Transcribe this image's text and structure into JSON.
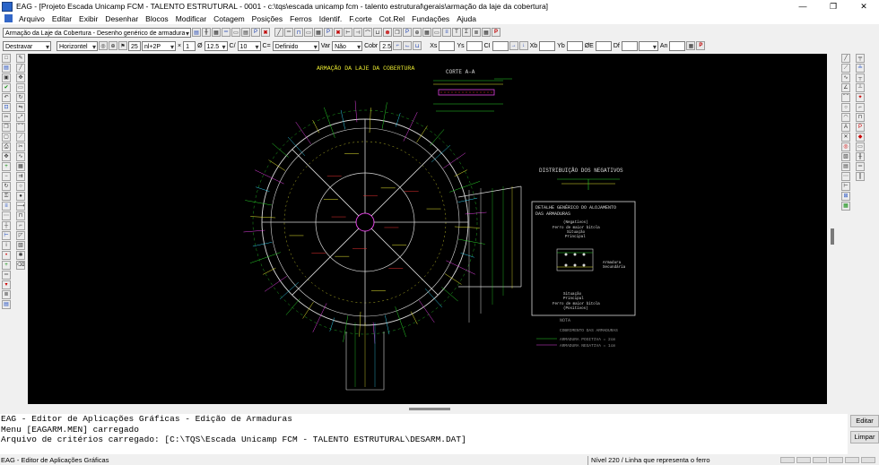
{
  "window": {
    "title": "EAG - [Projeto Escada Unicamp FCM - TALENTO ESTRUTURAL - 0001 - c:\\tqs\\escada unicamp fcm - talento estrutural\\gerais\\armação da laje da cobertura]",
    "minimize": "—",
    "maximize": "❐",
    "close": "✕"
  },
  "menu": [
    "Arquivo",
    "Editar",
    "Exibir",
    "Desenhar",
    "Blocos",
    "Modificar",
    "Cotagem",
    "Posições",
    "Ferros",
    "Identif.",
    "F.corte",
    "Cot.Rel",
    "Fundações",
    "Ajuda"
  ],
  "toolbar1": {
    "drawing_combo": "Armação da Laje da Cobertura - Desenho genérico de armadura"
  },
  "toolbar2": {
    "mode": "Destravar",
    "orientation": "Horizontel",
    "position_value": "25",
    "bar_spec": "nl+2P",
    "mult_label": "×",
    "mult_value": "1",
    "diameter_label": "Ø",
    "diameter_value": "12.5",
    "spacing_label": "C/",
    "spacing_value": "10",
    "c_label": "C=",
    "c_value": "Definido",
    "var_label": "Var",
    "var_value": "Não",
    "cobr_label": "Cobr",
    "cobr_value": "2.5",
    "xs_label": "Xs",
    "ys_label": "Ys",
    "ci_label": "CI",
    "xb_label": "Xb",
    "yb_label": "Yb",
    "oe_label": "ØE",
    "df_label": "Df",
    "an_label": "An"
  },
  "drawing": {
    "main_title": "ARMAÇÃO DA LAJE DA COBERTURA",
    "section_title": "CORTE A-A",
    "negatives_title": "DISTRIBUIÇÃO DOS NEGATIVOS",
    "detail_title_1": "DETALHE GENÉRICO DO ALOJAMENTO",
    "detail_title_2": "DAS ARMADURAS",
    "detail_neg": "(Negativos)",
    "detail_ferro1": "Ferro de maior bitola",
    "detail_sit1": "Situação",
    "detail_princ1": "Principal",
    "detail_arm": "Armadura",
    "detail_sec": "Secundária",
    "detail_sit2": "Situação",
    "detail_princ2": "Principal",
    "detail_ferro2": "Ferro de maior bitola",
    "detail_pos": "(Positivos)",
    "note_title": "NOTA",
    "note1": "COBRIMENTO DAS ARMADURAS",
    "note2": "ARMADURA POSITIVA = 2cm",
    "note3": "ARMADURA NEGATIVA = 1cm",
    "colors": {
      "structure": "#d8d8d8",
      "steel_pos": "#e8e830",
      "steel_neg": "#28d028",
      "magenta": "#e040e0",
      "cyan": "#30c8e8",
      "red": "#e83030"
    }
  },
  "console": {
    "lines": [
      "EAG - Editor de Aplicações Gráficas - Edição de Armaduras",
      "Menu [EAGARM.MEN] carregado",
      "Arquivo de critérios carregado: [C:\\TQS\\Escada Unicamp FCM - TALENTO ESTRUTURAL\\DESARM.DAT]"
    ],
    "edit_button": "Editar",
    "clear_button": "Limpar"
  },
  "status": {
    "app": "EAG - Editor de Aplicações Gráficas",
    "level": "Nível 220 / Linha que representa o ferro"
  }
}
